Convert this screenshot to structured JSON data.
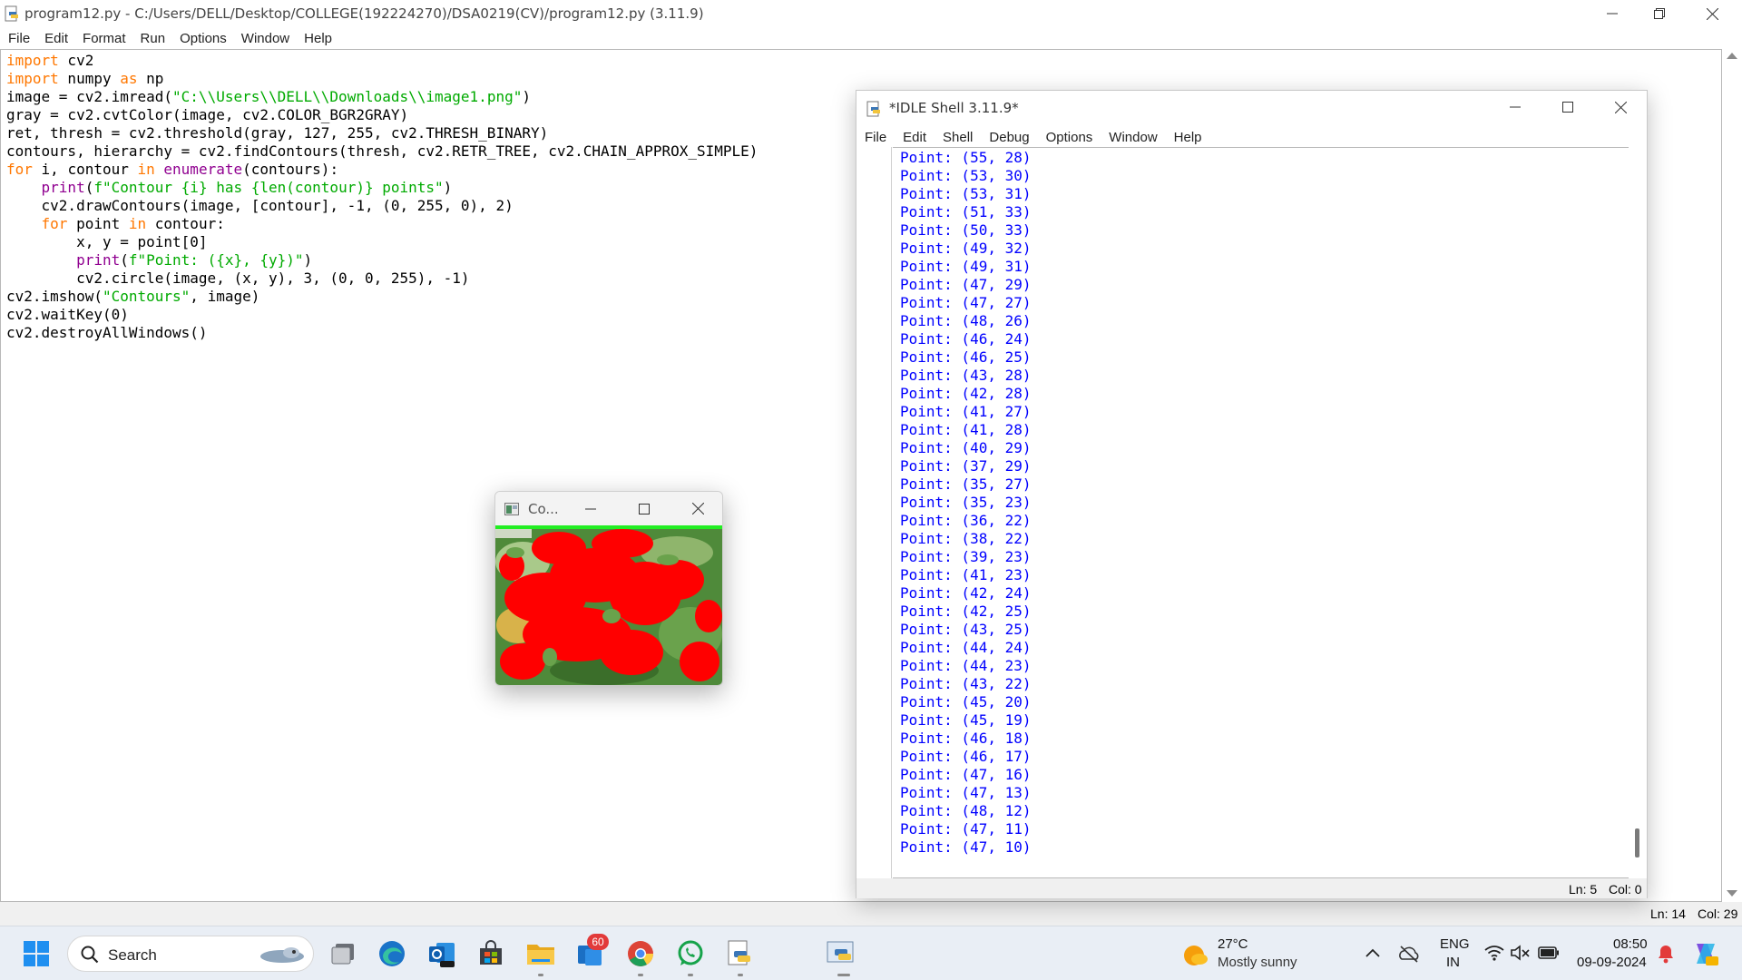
{
  "editor": {
    "title": "program12.py - C:/Users/DELL/Desktop/COLLEGE(192224270)/DSA0219(CV)/program12.py (3.11.9)",
    "menu": [
      "File",
      "Edit",
      "Format",
      "Run",
      "Options",
      "Window",
      "Help"
    ],
    "code": [
      "import cv2",
      "import numpy as np",
      "image = cv2.imread(\"C:\\\\Users\\\\DELL\\\\Downloads\\\\image1.png\")",
      "gray = cv2.cvtColor(image, cv2.COLOR_BGR2GRAY)",
      "ret, thresh = cv2.threshold(gray, 127, 255, cv2.THRESH_BINARY)",
      "contours, hierarchy = cv2.findContours(thresh, cv2.RETR_TREE, cv2.CHAIN_APPROX_SIMPLE)",
      "for i, contour in enumerate(contours):",
      "    print(f\"Contour {i} has {len(contour)} points\")",
      "    cv2.drawContours(image, [contour], -1, (0, 255, 0), 2)",
      "    for point in contour:",
      "        x, y = point[0]",
      "        print(f\"Point: ({x}, {y})\")",
      "        cv2.circle(image, (x, y), 3, (0, 0, 255), -1)",
      "cv2.imshow(\"Contours\", image)",
      "cv2.waitKey(0)",
      "cv2.destroyAllWindows()"
    ],
    "status": {
      "line": "Ln: 14",
      "col": "Col: 29"
    }
  },
  "shell": {
    "title": "*IDLE Shell 3.11.9*",
    "menu": [
      "File",
      "Edit",
      "Shell",
      "Debug",
      "Options",
      "Window",
      "Help"
    ],
    "output": [
      "Point: (55, 28)",
      "Point: (53, 30)",
      "Point: (53, 31)",
      "Point: (51, 33)",
      "Point: (50, 33)",
      "Point: (49, 32)",
      "Point: (49, 31)",
      "Point: (47, 29)",
      "Point: (47, 27)",
      "Point: (48, 26)",
      "Point: (46, 24)",
      "Point: (46, 25)",
      "Point: (43, 28)",
      "Point: (42, 28)",
      "Point: (41, 27)",
      "Point: (41, 28)",
      "Point: (40, 29)",
      "Point: (37, 29)",
      "Point: (35, 27)",
      "Point: (35, 23)",
      "Point: (36, 22)",
      "Point: (38, 22)",
      "Point: (39, 23)",
      "Point: (41, 23)",
      "Point: (42, 24)",
      "Point: (42, 25)",
      "Point: (43, 25)",
      "Point: (44, 24)",
      "Point: (44, 23)",
      "Point: (43, 22)",
      "Point: (45, 20)",
      "Point: (45, 19)",
      "Point: (46, 18)",
      "Point: (46, 17)",
      "Point: (47, 16)",
      "Point: (47, 13)",
      "Point: (48, 12)",
      "Point: (47, 11)",
      "Point: (47, 10)"
    ],
    "status": {
      "line": "Ln: 5",
      "col": "Col: 0"
    }
  },
  "contours_window": {
    "title": "Co..."
  },
  "taskbar": {
    "search_label": "Search",
    "notification_badge": "60",
    "weather": {
      "temp": "27°C",
      "condition": "Mostly sunny"
    },
    "language": {
      "lang": "ENG",
      "region": "IN"
    },
    "clock": {
      "time": "08:50",
      "date": "09-09-2024"
    },
    "apps": [
      "start-icon",
      "search-icon",
      "task-view-icon",
      "edge-icon",
      "outlook-icon",
      "store-icon",
      "file-explorer-icon",
      "notification-app-icon",
      "chrome-icon",
      "whatsapp-icon",
      "python-idle-icon",
      "python-idle-running-icon"
    ]
  },
  "colors": {
    "keyword": "#ff7700",
    "builtin": "#900090",
    "string": "#00aa00",
    "shell_output": "#0000ff"
  }
}
